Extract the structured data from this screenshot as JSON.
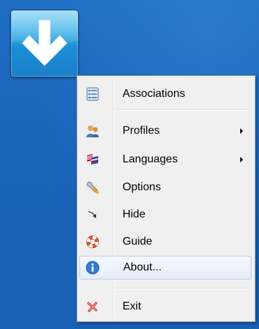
{
  "desktop": {
    "app_icon": {
      "icon": "download-arrow-icon",
      "colors": {
        "tile": "#2fa6e3",
        "arrow": "#ffffff"
      }
    }
  },
  "menu": {
    "items": [
      {
        "label": "Associations",
        "icon": "associations-list-icon"
      },
      {
        "label": "Profiles",
        "icon": "profiles-users-icon",
        "submenu": true
      },
      {
        "label": "Languages",
        "icon": "languages-flags-icon",
        "submenu": true
      },
      {
        "label": "Options",
        "icon": "wrench-icon"
      },
      {
        "label": "Hide",
        "icon": "hide-arrow-icon"
      },
      {
        "label": "Guide",
        "icon": "lifebuoy-icon"
      },
      {
        "label": "About...",
        "icon": "info-icon",
        "highlighted": true
      },
      {
        "label": "Exit",
        "icon": "close-x-icon"
      }
    ],
    "colors": {
      "background": "#f0f0f0",
      "highlight": "#e6eef8",
      "highlight_border": "#b9cfe8"
    }
  }
}
